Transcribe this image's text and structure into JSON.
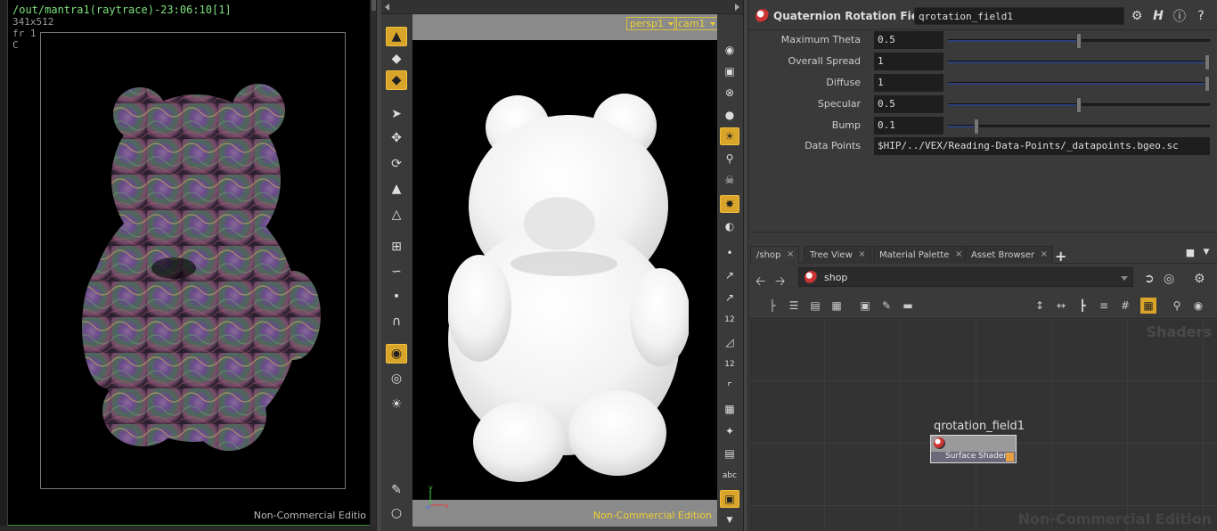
{
  "render_view": {
    "path": "/out/mantra1(raytrace)-23:06:10[1]",
    "resolution": "341x512",
    "frame": "fr 1",
    "channel": "C",
    "watermark": "Non-Commercial Editio"
  },
  "scene_viewer": {
    "camera_menu": "persp1",
    "cam_menu": "cam1",
    "watermark": "Non-Commercial Edition",
    "axis_y": "y",
    "axis_x": "x",
    "right_tool_labels": {
      "twelve_a": "12",
      "twelve_b": "12",
      "abc": "abc"
    }
  },
  "parameters": {
    "node_type": "Quaternion Rotation Field",
    "node_name": "qrotation_field1",
    "rows": [
      {
        "label": "Maximum Theta",
        "value": "0.5",
        "fraction": 0.5
      },
      {
        "label": "Overall Spread",
        "value": "1",
        "fraction": 1.0
      },
      {
        "label": "Diffuse",
        "value": "1",
        "fraction": 1.0
      },
      {
        "label": "Specular",
        "value": "0.5",
        "fraction": 0.5
      },
      {
        "label": "Bump",
        "value": "0.1",
        "fraction": 0.1
      }
    ],
    "data_points_label": "Data Points",
    "data_points_value": "$HIP/../VEX/Reading-Data-Points/_datapoints.bgeo.sc"
  },
  "network": {
    "tabs": [
      {
        "label": "/shop"
      },
      {
        "label": "Tree View"
      },
      {
        "label": "Material Palette"
      },
      {
        "label": "Asset Browser"
      }
    ],
    "path": "shop",
    "context_label": "Shaders",
    "watermark": "Non-Commercial Edition",
    "node": {
      "name": "qrotation_field1",
      "type": "Surface Shader"
    }
  },
  "colors": {
    "accent": "#d8a52a",
    "render_path_text": "#7fe07f",
    "viewport_menu": "#f0d030",
    "slider_fill": "#2f3f7a"
  }
}
